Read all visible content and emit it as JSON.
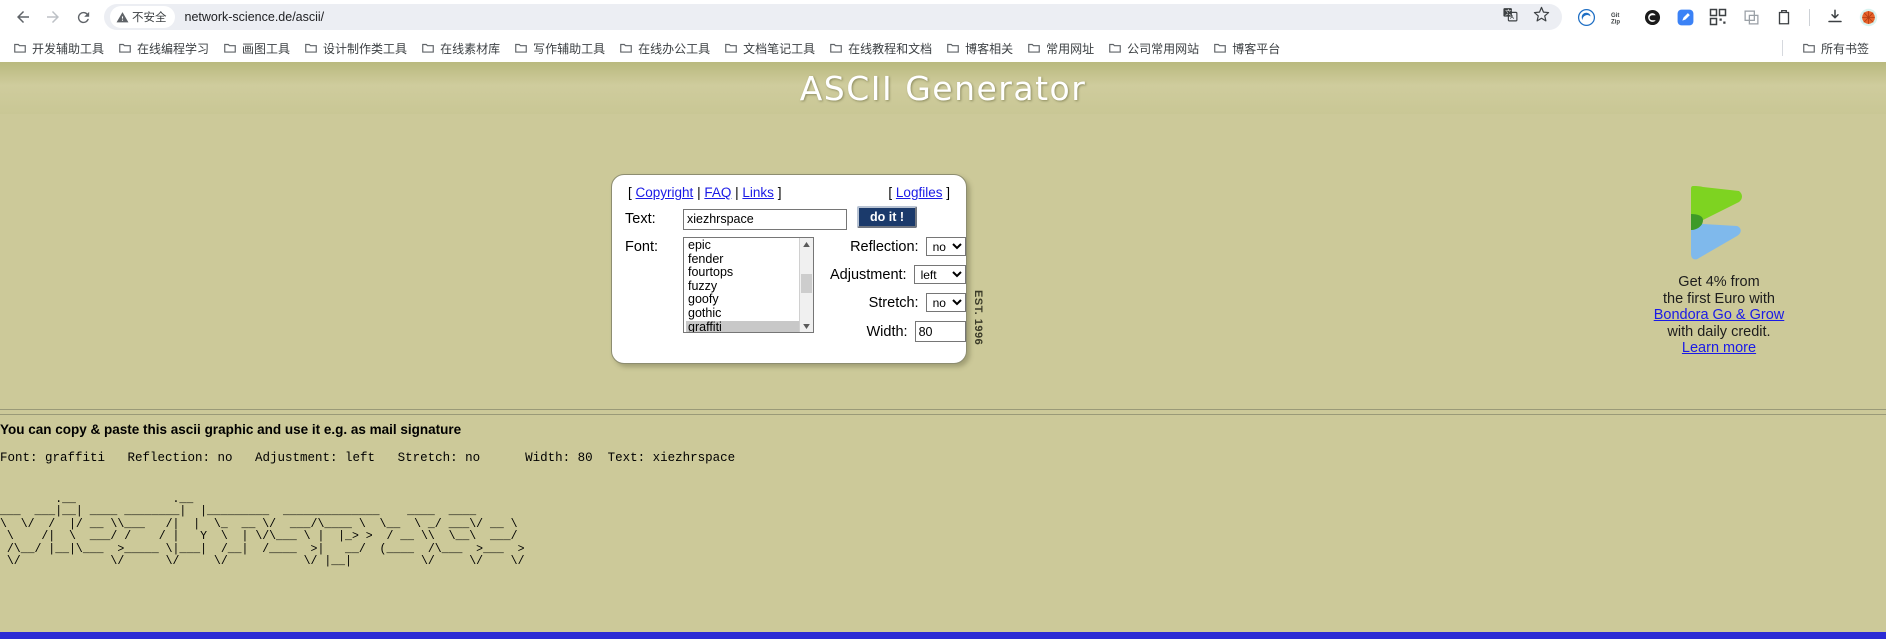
{
  "browser": {
    "nav": {
      "back": "back-arrow",
      "forward": "forward-arrow",
      "reload": "reload"
    },
    "omnibox": {
      "security_label": "不安全",
      "url": "network-science.de/ascii/",
      "translate_icon": "translate-icon",
      "bookmark_icon": "star-icon"
    },
    "extensions": [
      {
        "name": "edge-browser-icon",
        "glyph": "e"
      },
      {
        "name": "gitzip-icon",
        "glyph": "GitZip"
      },
      {
        "name": "black-circle-icon",
        "glyph": ""
      },
      {
        "name": "blue-pen-icon",
        "glyph": ""
      },
      {
        "name": "qr-code-icon",
        "glyph": ""
      },
      {
        "name": "screenshot-icon",
        "glyph": ""
      },
      {
        "name": "clipboard-icon",
        "glyph": ""
      },
      {
        "name": "downloads-icon",
        "glyph": ""
      },
      {
        "name": "profile-avatar",
        "glyph": ""
      }
    ],
    "bookmarks": [
      "开发辅助工具",
      "在线编程学习",
      "画图工具",
      "设计制作类工具",
      "在线素材库",
      "写作辅助工具",
      "在线办公工具",
      "文档笔记工具",
      "在线教程和文档",
      "博客相关",
      "常用网址",
      "公司常用网站",
      "博客平台"
    ],
    "bookmarks_overflow": "所有书签"
  },
  "page": {
    "title": "ASCII Generator",
    "nav_links": {
      "open_bracket": "[",
      "close_bracket": "]",
      "separator": "|",
      "copyright": "Copyright",
      "faq": "FAQ",
      "links": "Links",
      "logfiles": "Logfiles"
    },
    "form": {
      "text_label": "Text:",
      "text_value": "xiezhrspace",
      "submit_label": "do it !",
      "font_label": "Font:",
      "font_options": [
        "epic",
        "fender",
        "fourtops",
        "fuzzy",
        "goofy",
        "gothic",
        "graffiti"
      ],
      "font_selected": "graffiti",
      "reflection_label": "Reflection:",
      "reflection_value": "no",
      "adjustment_label": "Adjustment:",
      "adjustment_value": "left",
      "stretch_label": "Stretch:",
      "stretch_value": "no",
      "width_label": "Width:",
      "width_value": "80"
    },
    "est_mark": "EST. 1996",
    "ad": {
      "line1": "Get 4% from",
      "line2": "the first Euro with",
      "link_main": "Bondora Go & Grow",
      "line3": "with daily credit.",
      "link_more": "Learn more",
      "logo_green": "#7ed321",
      "logo_blue": "#7fb9ec",
      "logo_dark_green": "#3d9a28"
    },
    "output": {
      "headline": "You can copy & paste this ascii graphic and use it e.g. as mail signature",
      "params": "Font: graffiti   Reflection: no   Adjustment: left   Stretch: no      Width: 80  Text: xiezhrspace",
      "ascii_art": "        .__              .__\n___  ___|__| ____ ________|  |_________  ______________    ____  ____\n\\  \\/  /  |/ __ \\\\___   /|  |  \\_  __ \\/  ___/\\____ \\  \\__  \\ _/ ___\\/ __ \\\n \\    /|  \\  ___/ /    / |   Y  \\  | \\/\\___ \\ |  |_> >  / __ \\\\  \\__\\  ___/\n /\\__/ |__|\\___  >_____ \\|___|  /__|  /____  >|   __/  (____  /\\___  >___  >\n \\/             \\/      \\/     \\/           \\/ |__|          \\/     \\/    \\/"
    }
  },
  "colors": {
    "page_bg": "#ccc999",
    "link": "#1a1ae6",
    "button_bg": "#1b3a6b",
    "accent_blue": "#2b2bd4"
  }
}
